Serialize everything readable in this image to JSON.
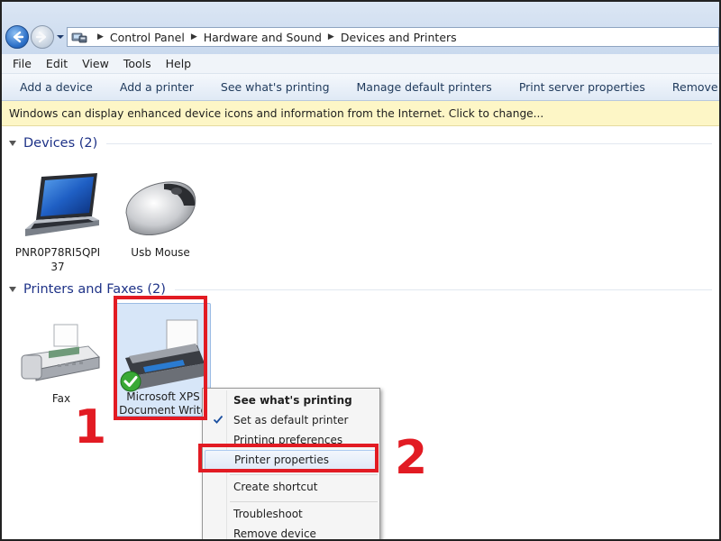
{
  "address": {
    "crumbs": [
      "Control Panel",
      "Hardware and Sound",
      "Devices and Printers"
    ]
  },
  "menu": [
    "File",
    "Edit",
    "View",
    "Tools",
    "Help"
  ],
  "commands": [
    "Add a device",
    "Add a printer",
    "See what's printing",
    "Manage default printers",
    "Print server properties",
    "Remove device"
  ],
  "infobar": "Windows can display enhanced device icons and information from the Internet. Click to change...",
  "groups": {
    "devices": {
      "title": "Devices (2)",
      "items": [
        {
          "label": "PNR0P78RI5QPI37",
          "icon": "laptop-icon"
        },
        {
          "label": "Usb Mouse",
          "icon": "mouse-icon"
        }
      ]
    },
    "printers": {
      "title": "Printers and Faxes (2)",
      "items": [
        {
          "label": "Fax",
          "icon": "fax-icon"
        },
        {
          "label": "Microsoft XPS Document Write",
          "icon": "printer-icon",
          "selected": true,
          "default": true
        }
      ]
    }
  },
  "context_menu": {
    "items": [
      {
        "label": "See what's printing",
        "bold": true
      },
      {
        "label": "Set as default printer",
        "checked": true
      },
      {
        "label": "Printing preferences"
      },
      {
        "label": "Printer properties",
        "highlighted": true
      },
      {
        "label": "Create shortcut"
      },
      {
        "label": "Troubleshoot"
      },
      {
        "label": "Remove device"
      }
    ]
  },
  "annotations": {
    "step1": "1",
    "step2": "2",
    "color": "#e21b23"
  }
}
